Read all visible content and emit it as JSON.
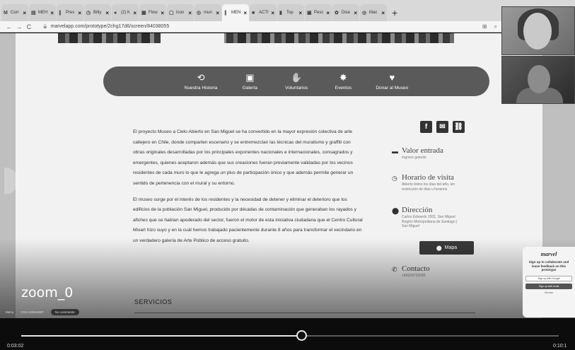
{
  "browser": {
    "tabs": [
      {
        "icon": "M",
        "label": "Corr"
      },
      {
        "icon": "▤",
        "label": "MEH"
      },
      {
        "icon": "∥",
        "label": "Pres"
      },
      {
        "icon": "◷",
        "label": "Bitly"
      },
      {
        "icon": "●",
        "label": "(2) K"
      },
      {
        "icon": "▦",
        "label": "Flow"
      },
      {
        "icon": "▢",
        "label": "Icon"
      },
      {
        "icon": "◎",
        "label": "mun"
      },
      {
        "icon": "∥",
        "label": "MEN",
        "active": true
      },
      {
        "icon": "■",
        "label": "ACTI"
      },
      {
        "icon": "▮",
        "label": "Top"
      },
      {
        "icon": "▣",
        "label": "Pesc"
      },
      {
        "icon": "✿",
        "label": "Dise"
      },
      {
        "icon": "◎",
        "label": "Mac"
      }
    ],
    "new_tab": "+",
    "url": "marvelapp.com/prototype/2chg17d6/screen/84038055"
  },
  "site": {
    "nav": [
      {
        "icon": "history-icon",
        "glyph": "⟲",
        "label": "Nuestra Historia"
      },
      {
        "icon": "gallery-icon",
        "glyph": "▣",
        "label": "Galería"
      },
      {
        "icon": "hand-icon",
        "glyph": "✋",
        "label": "Voluntarios"
      },
      {
        "icon": "events-icon",
        "glyph": "✸",
        "label": "Eventos"
      },
      {
        "icon": "donate-icon",
        "glyph": "♥",
        "label": "Donar al Museo"
      }
    ],
    "paragraph1": "El proyecto Museo a Cielo Abierto en San Miguel se ha convertido en la mayor expresión colectiva de arte callejero en Chile, donde comparten escenario y se entremezclan las técnicas del muralismo y graffiti con obras originales desarrolladas por los principales exponentes nacionales e internacionales, consagrados y emergentes, quienes aceptaron además que sus creaciones fueran previamente validadas por los vecinos residentes de cada muro lo que le agrega un plus de participación único y que además permite generar un sentido de pertenencia con el mural y su entorno.",
    "paragraph2": "El museo surge por el interés de los residentes y la necesidad de detener y eliminar el deterioro que los edificios de la población San Miguel, producido por décadas de contaminación que generaban los rayados y afiches que se habían apoderado del sector, fueron el motor de esta iniciativa ciudadana que el Centro Cultural Mixart hizo suyo y en la cuál hemos trabajado pacientemente durante 8 años para transformar el vecindario en un verdadero galería de Arte Público de acceso gratuito.",
    "social": [
      "f",
      "✉",
      "🔗"
    ],
    "info": {
      "valor_title": "Valor entrada",
      "valor_sub": "Ingreso gratuito",
      "horario_title": "Horario de visita",
      "horario_sub": "Abierto todos los días del año, sin restricción de días u horarios",
      "direccion_title": "Dirección",
      "direccion_sub": "Carlos Edwards 1502, San Miguel. Región Metropolitana de Santiago | San Miguel",
      "mapa_label": "Mapa",
      "contacto_title": "Contacto",
      "contacto_sub": "+56229722095"
    },
    "servicios": "SERVICIOS"
  },
  "marvel_widget": {
    "logo": "marvel",
    "text": "Sign up to collaborate and leave feedback on this prototype",
    "btn_google": "Sign up with Google",
    "btn_email": "Sign up with email",
    "dismiss": "Dismiss"
  },
  "recording": {
    "watermark": "zoom_0",
    "footer_left": "Menu",
    "footer_mid": "3:03 Art/MUSEF",
    "footer_pill": "No comments"
  },
  "player": {
    "current_time": "0:03:02",
    "total_time": "0:10:1",
    "progress": 0.522
  }
}
